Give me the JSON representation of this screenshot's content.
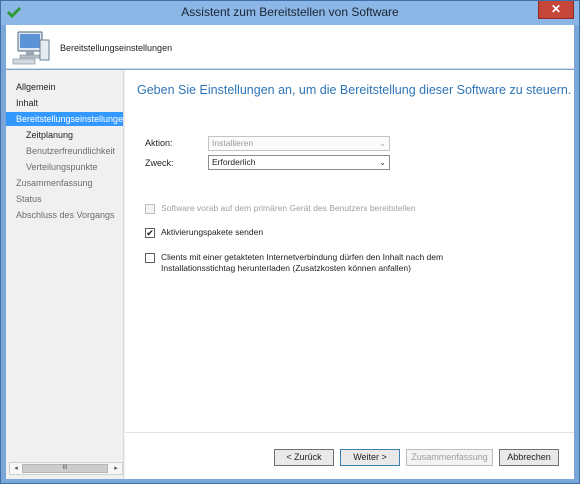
{
  "window": {
    "title": "Assistent zum Bereitstellen von Software",
    "close_label": "✕"
  },
  "header": {
    "title": "Bereitstellungseinstellungen"
  },
  "sidebar": {
    "items": [
      {
        "label": "Allgemein"
      },
      {
        "label": "Inhalt"
      },
      {
        "label": "Bereitstellungseinstellungen"
      },
      {
        "label": "Zeitplanung"
      },
      {
        "label": "Benutzerfreundlichkeit"
      },
      {
        "label": "Verteilungspunkte"
      },
      {
        "label": "Zusammenfassung"
      },
      {
        "label": "Status"
      },
      {
        "label": "Abschluss des Vorgangs"
      }
    ],
    "scroll_left": "◂",
    "scroll_right": "▸",
    "scroll_thumb": "III"
  },
  "main": {
    "heading": "Geben Sie Einstellungen an, um die Bereitstellung dieser Software zu steuern.",
    "aktion": {
      "label": "Aktion:",
      "value": "Installieren"
    },
    "zweck": {
      "label": "Zweck:",
      "value": "Erforderlich"
    },
    "checkboxes": {
      "vorab": {
        "label": "Software vorab auf dem primären Gerät des Benutzers bereitstellen",
        "checked": false
      },
      "aktivierung": {
        "label": "Aktivierungspakete senden",
        "checked": true
      },
      "getaktet": {
        "label_line1": "Clients mit einer getakteten Internetverbindung dürfen den Inhalt nach dem",
        "label_line2": "Installationsstichtag herunterladen (Zusatzkosten können anfallen)",
        "checked": false
      }
    }
  },
  "footer": {
    "back": "< Zurück",
    "next": "Weiter >",
    "summary": "Zusammenfassung",
    "cancel": "Abbrechen"
  },
  "icons": {
    "check_mark": "✔",
    "chevron": "⌄"
  },
  "colors": {
    "heading": "#2e75b6",
    "nav_selected": "#3399ff",
    "titlebar": "#8cb6e6"
  }
}
